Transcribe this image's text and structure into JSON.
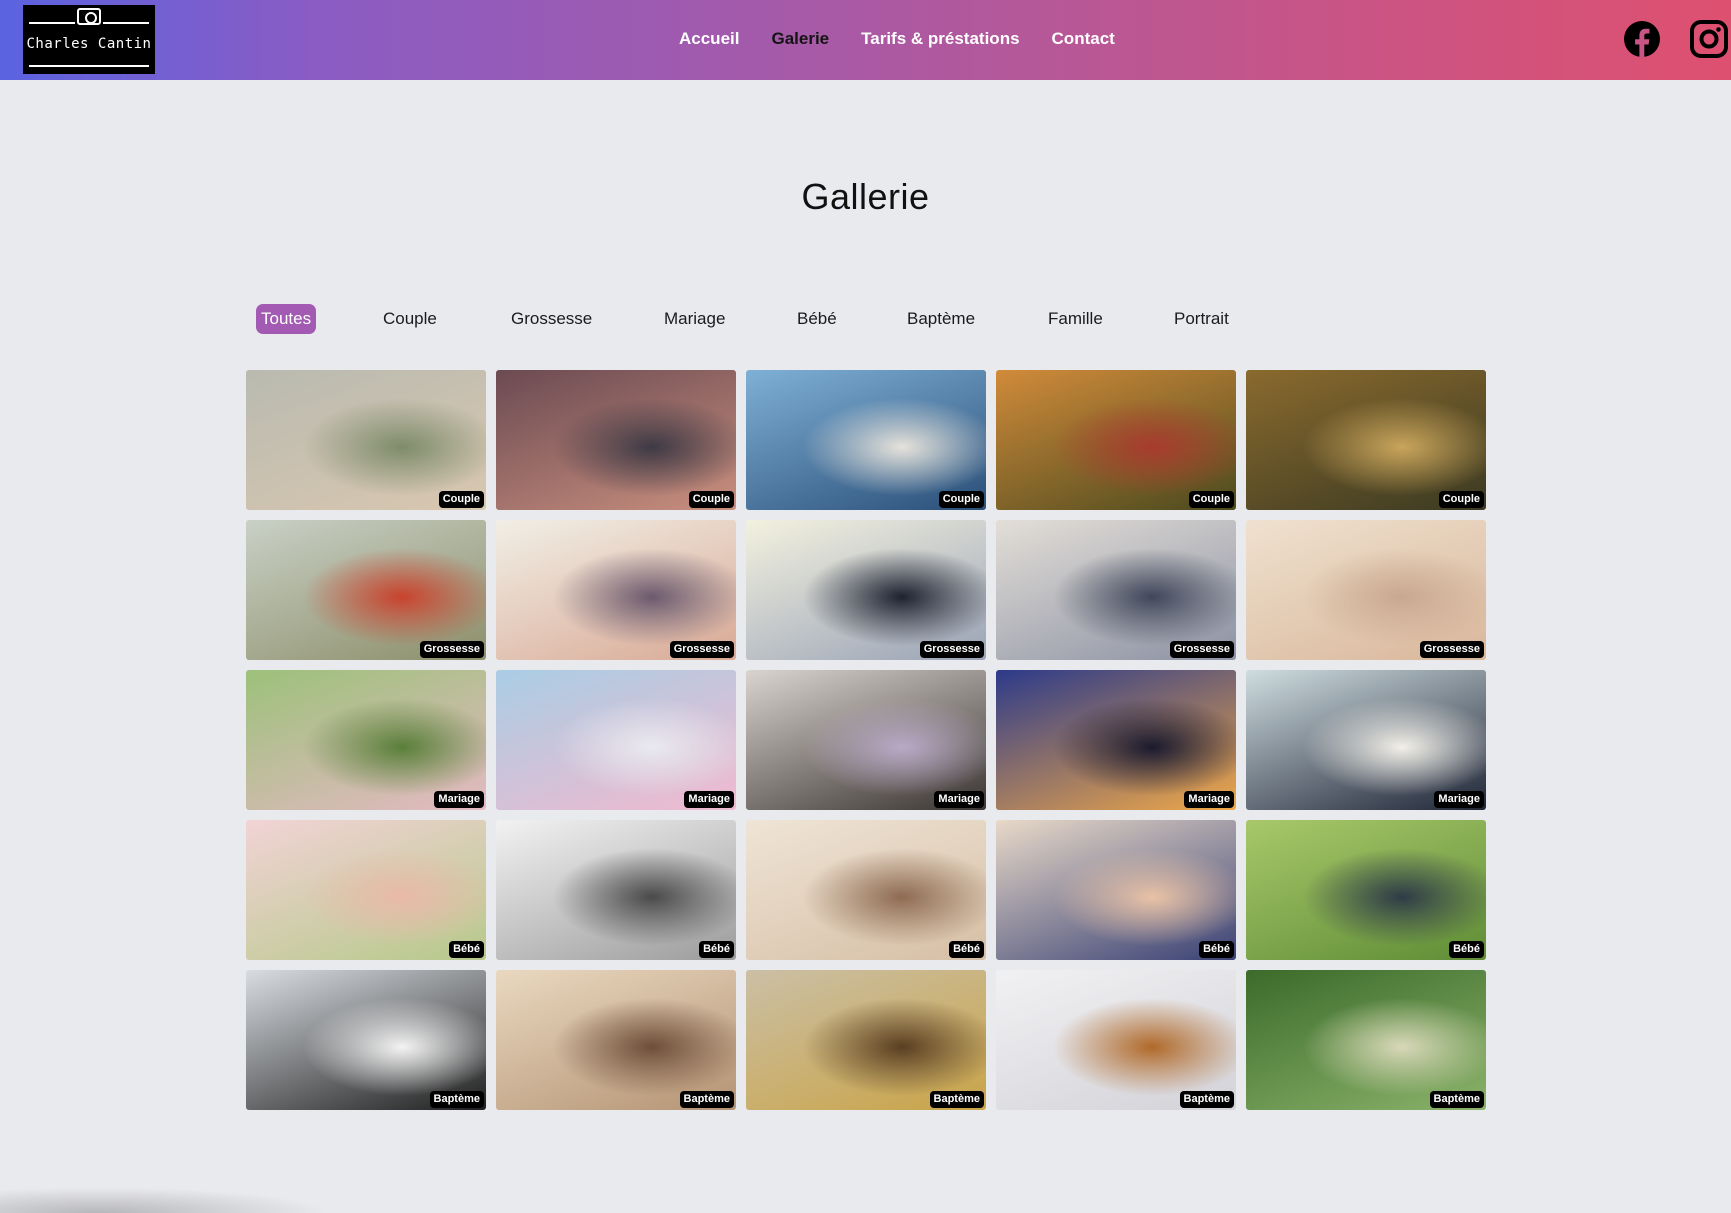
{
  "header": {
    "logo_text": "Charles Cantin",
    "nav": [
      {
        "label": "Accueil",
        "active": false
      },
      {
        "label": "Galerie",
        "active": true
      },
      {
        "label": "Tarifs & préstations",
        "active": false
      },
      {
        "label": "Contact",
        "active": false
      }
    ],
    "social": [
      "facebook-icon",
      "instagram-icon"
    ]
  },
  "page_title": "Gallerie",
  "filters": [
    {
      "label": "Toutes",
      "active": true
    },
    {
      "label": "Couple",
      "active": false
    },
    {
      "label": "Grossesse",
      "active": false
    },
    {
      "label": "Mariage",
      "active": false
    },
    {
      "label": "Bébé",
      "active": false
    },
    {
      "label": "Baptème",
      "active": false
    },
    {
      "label": "Famille",
      "active": false
    },
    {
      "label": "Portrait",
      "active": false
    }
  ],
  "gallery": [
    {
      "tag": "Couple",
      "colors": [
        "#b9bab0",
        "#d9c7b0",
        "#7e8c6a"
      ]
    },
    {
      "tag": "Couple",
      "colors": [
        "#6b4a52",
        "#c98f7e",
        "#3e3a45"
      ]
    },
    {
      "tag": "Couple",
      "colors": [
        "#7fb0d6",
        "#2a4f78",
        "#e6e2da"
      ]
    },
    {
      "tag": "Couple",
      "colors": [
        "#d18b3a",
        "#4b4a1e",
        "#a83b2e"
      ]
    },
    {
      "tag": "Couple",
      "colors": [
        "#8a6a2e",
        "#3b3a22",
        "#c9a55c"
      ]
    },
    {
      "tag": "Grossesse",
      "colors": [
        "#c9d0c6",
        "#8d8f6a",
        "#c9432e"
      ]
    },
    {
      "tag": "Grossesse",
      "colors": [
        "#f1efe6",
        "#d9a995",
        "#6b5a6e"
      ]
    },
    {
      "tag": "Grossesse",
      "colors": [
        "#f3f1df",
        "#9aa3b6",
        "#1d2230"
      ]
    },
    {
      "tag": "Grossesse",
      "colors": [
        "#e3ded7",
        "#8c92a4",
        "#40475a"
      ]
    },
    {
      "tag": "Grossesse",
      "colors": [
        "#efe1cf",
        "#d9b79b",
        "#c9a890"
      ]
    },
    {
      "tag": "Mariage",
      "colors": [
        "#9cc17a",
        "#e4b9c2",
        "#5a7f3a"
      ]
    },
    {
      "tag": "Mariage",
      "colors": [
        "#a9cde4",
        "#f1b9cf",
        "#e9e9ef"
      ]
    },
    {
      "tag": "Mariage",
      "colors": [
        "#d9d4ce",
        "#3a3432",
        "#b9a9c6"
      ]
    },
    {
      "tag": "Mariage",
      "colors": [
        "#2c3a8a",
        "#f0a848",
        "#1a1a2e"
      ]
    },
    {
      "tag": "Mariage",
      "colors": [
        "#cfdde0",
        "#1f2536",
        "#f2efe8"
      ]
    },
    {
      "tag": "Bébé",
      "colors": [
        "#f2d3d6",
        "#b6c98a",
        "#e9b9a8"
      ]
    },
    {
      "tag": "Bébé",
      "colors": [
        "#f2f2f2",
        "#9c9c9c",
        "#4a4a4a"
      ]
    },
    {
      "tag": "Bébé",
      "colors": [
        "#efe4d6",
        "#d6bfa5",
        "#8e6b52"
      ]
    },
    {
      "tag": "Bébé",
      "colors": [
        "#e8d9c8",
        "#3a4275",
        "#e9c2a6"
      ]
    },
    {
      "tag": "Bébé",
      "colors": [
        "#a8c86a",
        "#5f8d36",
        "#2f3b48"
      ]
    },
    {
      "tag": "Baptème",
      "colors": [
        "#d9dde2",
        "#1e1e1e",
        "#f3f3f3"
      ]
    },
    {
      "tag": "Baptème",
      "colors": [
        "#e9d8c0",
        "#b59474",
        "#6e4e3a"
      ]
    },
    {
      "tag": "Baptème",
      "colors": [
        "#cbbfa5",
        "#c9a448",
        "#5a3f22"
      ]
    },
    {
      "tag": "Baptème",
      "colors": [
        "#f1f1f3",
        "#d3d2d8",
        "#b06a2a"
      ]
    },
    {
      "tag": "Baptème",
      "colors": [
        "#3b6b2a",
        "#8ab26a",
        "#d8d8b8"
      ]
    }
  ]
}
